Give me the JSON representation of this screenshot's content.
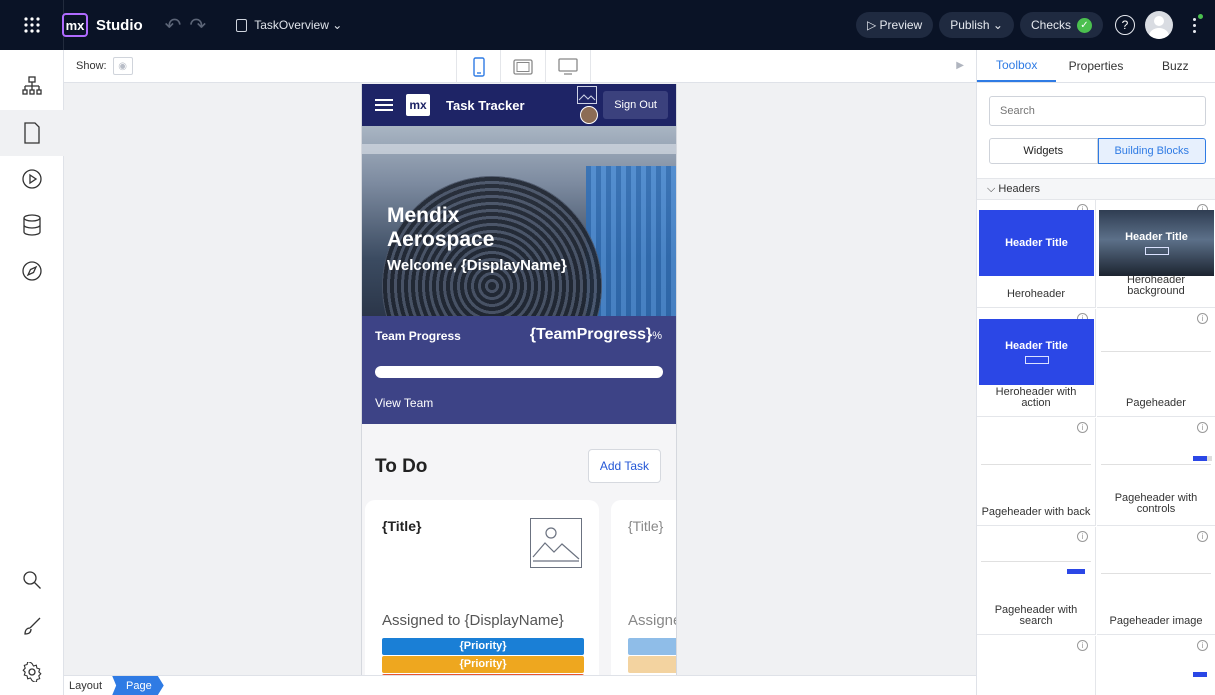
{
  "topbar": {
    "app_name": "Studio",
    "document": "TaskOverview ⌄",
    "preview": "▷ Preview",
    "publish": "Publish ⌄",
    "checks": "Checks",
    "check_mark": "✓",
    "help": "?"
  },
  "canvas_header": {
    "show_label": "Show:"
  },
  "phone": {
    "app_title": "Task Tracker",
    "sign_out": "Sign Out",
    "mx": "mx",
    "hero_title_1": "Mendix",
    "hero_title_2": "Aerospace",
    "hero_welcome": "Welcome, {DisplayName}",
    "team_progress_label": "Team Progress",
    "team_progress_value": "{TeamProgress}",
    "team_progress_unit": "%",
    "view_team": "View Team",
    "todo_title": "To Do",
    "add_task": "Add Task",
    "cards": [
      {
        "title": "{Title}",
        "assigned": "Assigned to {DisplayName}",
        "priorities": [
          "{Priority}",
          "{Priority}"
        ]
      },
      {
        "title": "{Title}",
        "assigned": "Assigne"
      }
    ]
  },
  "bottombar": {
    "crumbs": [
      "Layout",
      "Page"
    ]
  },
  "right_panel": {
    "tabs": [
      "Toolbox",
      "Properties",
      "Buzz"
    ],
    "active_tab": "Toolbox",
    "search_placeholder": "Search",
    "segments": [
      "Widgets",
      "Building Blocks"
    ],
    "active_segment": "Building Blocks",
    "section_title": "⌵ Headers",
    "blocks": [
      {
        "label": "Heroheader",
        "thumb_title": "Header Title"
      },
      {
        "label": "Heroheader background",
        "thumb_title": "Header Title"
      },
      {
        "label": "Heroheader with action",
        "thumb_title": "Header Title"
      },
      {
        "label": "Pageheader"
      },
      {
        "label": "Pageheader with back"
      },
      {
        "label": "Pageheader with controls"
      },
      {
        "label": "Pageheader with search"
      },
      {
        "label": "Pageheader image"
      }
    ]
  },
  "colors": {
    "accent": "#2f7be4",
    "app_bar": "#1e2466",
    "priority_1": "#1a7fd6",
    "priority_2": "#eea71f",
    "checks_ok": "#4bc04f"
  }
}
